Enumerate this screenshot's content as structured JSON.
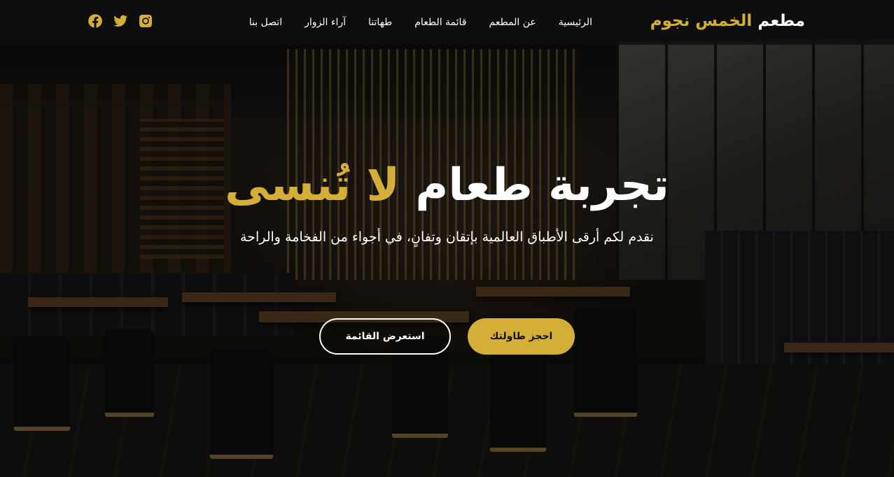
{
  "brand": {
    "name": "مطعم",
    "accent": "الخمس نجوم"
  },
  "nav": {
    "items": [
      {
        "label": "الرئيسية"
      },
      {
        "label": "عن المطعم"
      },
      {
        "label": "قائمة الطعام"
      },
      {
        "label": "طهاتنا"
      },
      {
        "label": "آراء الزوار"
      },
      {
        "label": "اتصل بنا"
      }
    ]
  },
  "socials": [
    "instagram-icon",
    "twitter-icon",
    "facebook-icon"
  ],
  "hero": {
    "title_main": "تجربة طعام",
    "title_accent": "لا تُنسى",
    "subtitle": "نقدم لكم أرقى الأطباق العالمية بإتقان وتفانٍ، في أجواء من الفخامة والراحة",
    "primary_button": "احجز طاولتك",
    "secondary_button": "استعرض القائمة"
  },
  "colors": {
    "accent": "#d4af37",
    "navbar": "#101010",
    "text": "#ffffff"
  }
}
